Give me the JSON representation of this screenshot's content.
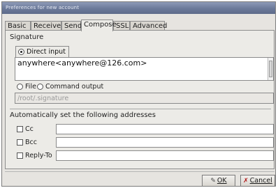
{
  "window": {
    "title": "Preferences for new account"
  },
  "tabs": [
    {
      "label": "Basic"
    },
    {
      "label": "Receive"
    },
    {
      "label": "Send"
    },
    {
      "label": "Compose",
      "active": true
    },
    {
      "label": "SSL"
    },
    {
      "label": "Advanced"
    }
  ],
  "signature": {
    "section_title": "Signature",
    "direct_input_label": "Direct input",
    "direct_input_selected": true,
    "text": "anywhere<anywhere@126.com>",
    "file_label": "File",
    "command_output_label": "Command output",
    "path_value": "/root/.signature"
  },
  "addresses": {
    "section_title": "Automatically set the following addresses",
    "rows": [
      {
        "label": "Cc",
        "checked": false,
        "value": ""
      },
      {
        "label": "Bcc",
        "checked": false,
        "value": ""
      },
      {
        "label": "Reply-To",
        "checked": false,
        "value": ""
      }
    ]
  },
  "buttons": {
    "ok_label": "OK",
    "cancel_label": "Cancel"
  },
  "icons": {
    "ok": "ok-icon",
    "cancel": "cancel-icon"
  }
}
